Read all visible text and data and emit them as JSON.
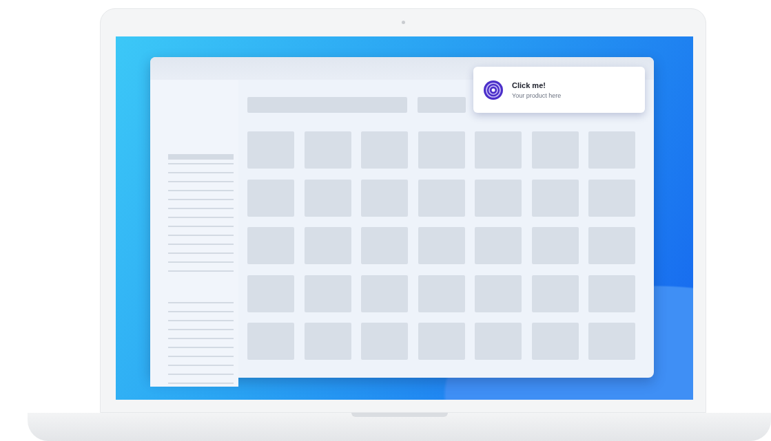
{
  "popup": {
    "title": "Click me!",
    "subtitle": "Your product here"
  }
}
